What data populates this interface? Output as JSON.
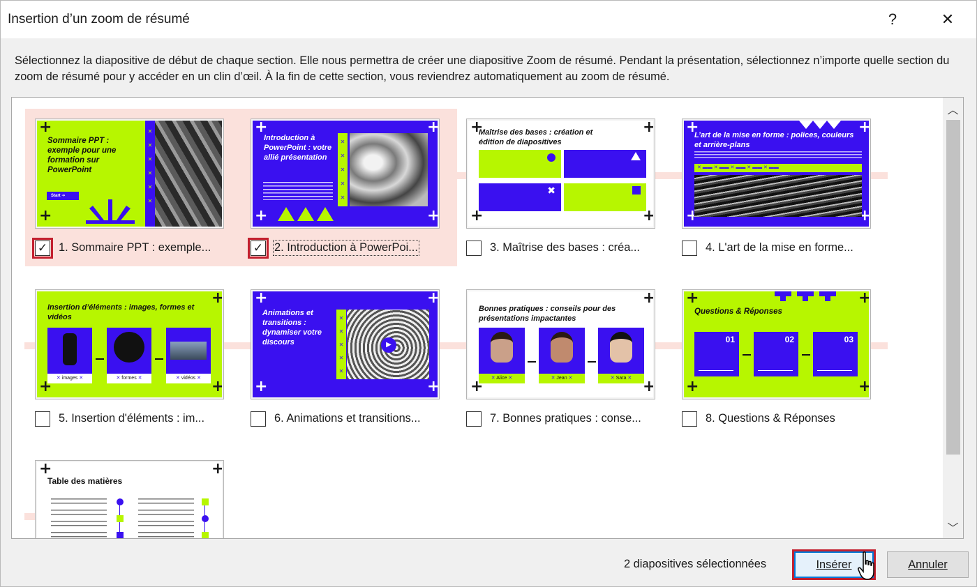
{
  "dialog": {
    "title": "Insertion d’un zoom de résumé",
    "help_glyph": "?",
    "close_glyph": "✕",
    "description": "Sélectionnez la diapositive de début de chaque section. Elle nous permettra de créer une diapositive Zoom de résumé. Pendant la présentation, sélectionnez n’importe quelle section du zoom de résumé pour y accéder en un clin d’œil. À la fin de cette section, vous reviendrez automatiquement au zoom de résumé."
  },
  "slides": [
    {
      "label": "1. Sommaire PPT : exemple...",
      "checked": true,
      "title": "Sommaire PPT : exemple pour une formation sur PowerPoint",
      "button": "Start"
    },
    {
      "label": "2.  Introduction à PowerPoi...",
      "checked": true,
      "title": "Introduction à PowerPoint : votre allié présentation"
    },
    {
      "label": "3. Maîtrise des bases : créa...",
      "checked": false,
      "title": "Maîtrise des bases : création et édition de diapositives"
    },
    {
      "label": "4. L'art de la mise en forme...",
      "checked": false,
      "title": "L’art de la mise en forme : polices, couleurs et arrière-plans"
    },
    {
      "label": "5. Insertion d'éléments : im...",
      "checked": false,
      "title": "Insertion d’éléments : images, formes et vidéos",
      "captions": [
        "images",
        "formes",
        "vidéos"
      ]
    },
    {
      "label": "6. Animations  et transitions...",
      "checked": false,
      "title": "Animations et transitions : dynamiser votre discours"
    },
    {
      "label": "7. Bonnes pratiques : conse...",
      "checked": false,
      "title": "Bonnes pratiques : conseils pour des présentations impactantes",
      "names": [
        "Alice",
        "Jean",
        "Sara"
      ]
    },
    {
      "label": "8. Questions & Réponses",
      "checked": false,
      "title": "Questions & Réponses",
      "numbers": [
        "01",
        "02",
        "03"
      ]
    },
    {
      "label": "",
      "checked": false,
      "title": "Table des matières"
    }
  ],
  "footer": {
    "status": "2 diapositives sélectionnées",
    "insert_label": "Insérer",
    "cancel_label": "Annuler"
  },
  "colors": {
    "lime": "#b7f600",
    "blue": "#3a10f0",
    "selection": "#fbe1dc",
    "checkbox_highlight": "#c3202f"
  }
}
